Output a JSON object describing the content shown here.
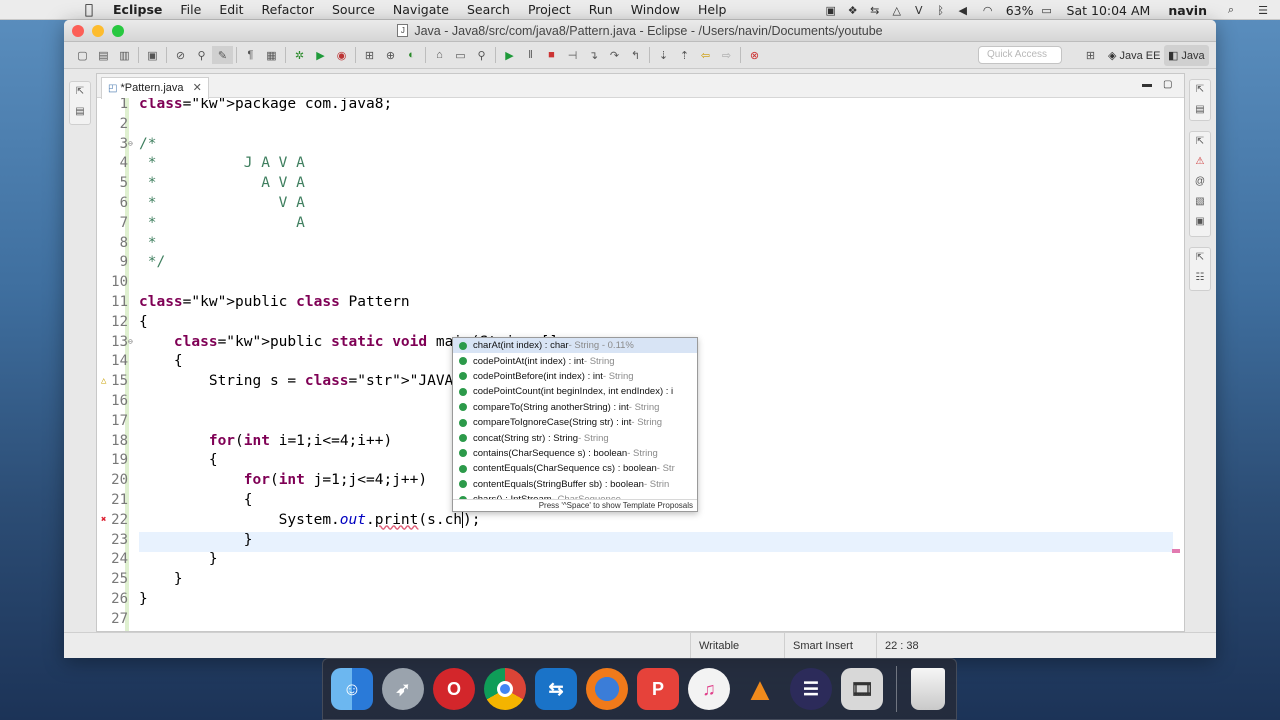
{
  "menubar": {
    "apple": "",
    "app": "Eclipse",
    "items": [
      "File",
      "Edit",
      "Refactor",
      "Source",
      "Navigate",
      "Search",
      "Project",
      "Run",
      "Window",
      "Help"
    ],
    "battery": "63%",
    "clock": "Sat 10:04 AM",
    "user": "navin"
  },
  "window": {
    "title": "Java - Java8/src/com/java8/Pattern.java - Eclipse - /Users/navin/Documents/youtube"
  },
  "toolbar": {
    "quick_access_placeholder": "Quick Access",
    "perspective_javaee": "Java EE",
    "perspective_java": "Java"
  },
  "editor": {
    "tab_label": "*Pattern.java",
    "tab_close": "✕",
    "lines": [
      {
        "n": "1",
        "t": "package com.java8;"
      },
      {
        "n": "2",
        "t": ""
      },
      {
        "n": "3",
        "t": "/*"
      },
      {
        "n": "4",
        "t": " *          J A V A"
      },
      {
        "n": "5",
        "t": " *            A V A"
      },
      {
        "n": "6",
        "t": " *              V A"
      },
      {
        "n": "7",
        "t": " *                A"
      },
      {
        "n": "8",
        "t": " *"
      },
      {
        "n": "9",
        "t": " */"
      },
      {
        "n": "10",
        "t": ""
      },
      {
        "n": "11",
        "t": "public class Pattern"
      },
      {
        "n": "12",
        "t": "{"
      },
      {
        "n": "13",
        "t": "    public static void main(String []"
      },
      {
        "n": "14",
        "t": "    {"
      },
      {
        "n": "15",
        "t": "        String s = \"JAVA\";"
      },
      {
        "n": "16",
        "t": ""
      },
      {
        "n": "17",
        "t": ""
      },
      {
        "n": "18",
        "t": "        for(int i=1;i<=4;i++)"
      },
      {
        "n": "19",
        "t": "        {"
      },
      {
        "n": "20",
        "t": "            for(int j=1;j<=4;j++)"
      },
      {
        "n": "21",
        "t": "            {"
      },
      {
        "n": "22",
        "t": "                System.out.print(s.ch);"
      },
      {
        "n": "23",
        "t": "            }"
      },
      {
        "n": "24",
        "t": "        }"
      },
      {
        "n": "25",
        "t": "    }"
      },
      {
        "n": "26",
        "t": "}"
      },
      {
        "n": "27",
        "t": ""
      }
    ]
  },
  "autocomplete": {
    "items": [
      {
        "sig": "charAt(int index) : char",
        "ty": " - String - 0.11%",
        "selected": true
      },
      {
        "sig": "codePointAt(int index) : int",
        "ty": " - String"
      },
      {
        "sig": "codePointBefore(int index) : int",
        "ty": " - String"
      },
      {
        "sig": "codePointCount(int beginIndex, int endIndex) : i",
        "ty": ""
      },
      {
        "sig": "compareTo(String anotherString) : int",
        "ty": " - String"
      },
      {
        "sig": "compareToIgnoreCase(String str) : int",
        "ty": " - String"
      },
      {
        "sig": "concat(String str) : String",
        "ty": " - String"
      },
      {
        "sig": "contains(CharSequence s) : boolean",
        "ty": " - String"
      },
      {
        "sig": "contentEquals(CharSequence cs) : boolean",
        "ty": " - Str"
      },
      {
        "sig": "contentEquals(StringBuffer sb) : boolean",
        "ty": " - Strin"
      },
      {
        "sig": "chars() : IntStream",
        "ty": " - CharSequence"
      }
    ],
    "footer": "Press '^Space' to show Template Proposals"
  },
  "status": {
    "writable": "Writable",
    "insert_mode": "Smart Insert",
    "position": "22 : 38"
  },
  "dock": {
    "items": [
      "finder-icon",
      "launchpad-icon",
      "opera-icon",
      "chrome-icon",
      "teamviewer-icon",
      "firefox-icon",
      "wps-icon",
      "itunes-icon",
      "vlc-icon",
      "eclipse-icon",
      "photo-slideshow-icon",
      "trash-icon"
    ]
  },
  "colors": {
    "keyword": "#7f0055",
    "comment": "#3f7f5f",
    "string": "#2a00ff",
    "field": "#0000c0"
  }
}
